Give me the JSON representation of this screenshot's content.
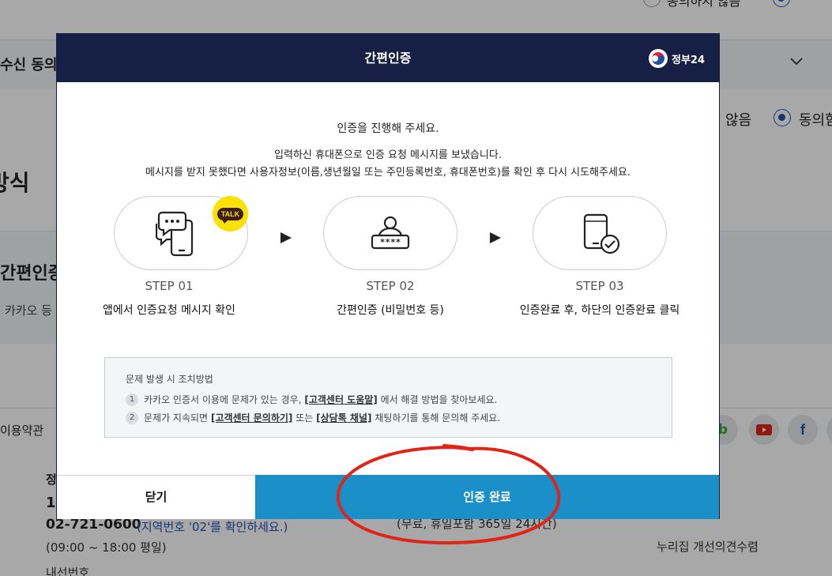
{
  "background": {
    "top_radio_label": "동의하지 않음",
    "row_label": "수신 동의",
    "radio_no": "않음",
    "radio_yes": "동의함",
    "section_heading": "방식",
    "easy_auth_label": "간편인증",
    "kakao_text": "카카오 등",
    "footer_terms": "이용약관",
    "footer_org": "정",
    "phone_partial": "1",
    "phone": "02-721-0600",
    "area_code_note": "(지역번호 '02'를 확인하세요.)",
    "hours": "(09:00 ~ 18:00 평일)",
    "extension": "내선번호",
    "free_note": "(무료, 휴일포함 365일 24시간)",
    "improvement": "누리집 개선의견수렴",
    "sns": [
      "blog",
      "youtube",
      "facebook"
    ]
  },
  "modal": {
    "title": "간편인증",
    "gov_logo_text": "정부24",
    "intro": "인증을 진행해 주세요.",
    "sent_notice": "입력하신 휴대폰으로 인증 요청 메시지를 보냈습니다.",
    "retry_notice": "메시지를 받지 못했다면 사용자정보(이름,생년월일 또는 주민등록번호, 휴대폰번호)를 확인 후 다시 시도해주세요.",
    "talk_badge": "TALK",
    "steps": [
      {
        "label": "STEP 01",
        "desc": "앱에서 인증요청 메시지 확인",
        "icon": "chat-phone-icon"
      },
      {
        "label": "STEP 02",
        "desc": "간편인증 (비밀번호 등)",
        "icon": "password-user-icon"
      },
      {
        "label": "STEP 03",
        "desc": "인증완료 후, 하단의 인증완료 클릭",
        "icon": "phone-check-icon"
      }
    ],
    "trouble": {
      "title": "문제 발생 시 조치방법",
      "item1": {
        "num": "1",
        "pre": "카카오 인증서 이용에 문제가 있는 경우,",
        "link": "[고객센터 도움말]",
        "post": "에서 해결 방법을 찾아보세요."
      },
      "item2": {
        "num": "2",
        "pre": "문제가 지속되면",
        "link1": "[고객센터 문의하기]",
        "mid": "또는",
        "link2": "[상담톡 채널]",
        "post": "채팅하기를 통해 문의해 주세요."
      }
    },
    "close_label": "닫기",
    "complete_label": "인증 완료"
  },
  "colors": {
    "header_navy": "#152044",
    "complete_blue": "#1a8fc8",
    "kakao_yellow": "#fae100",
    "annotation_red": "#e02418"
  }
}
